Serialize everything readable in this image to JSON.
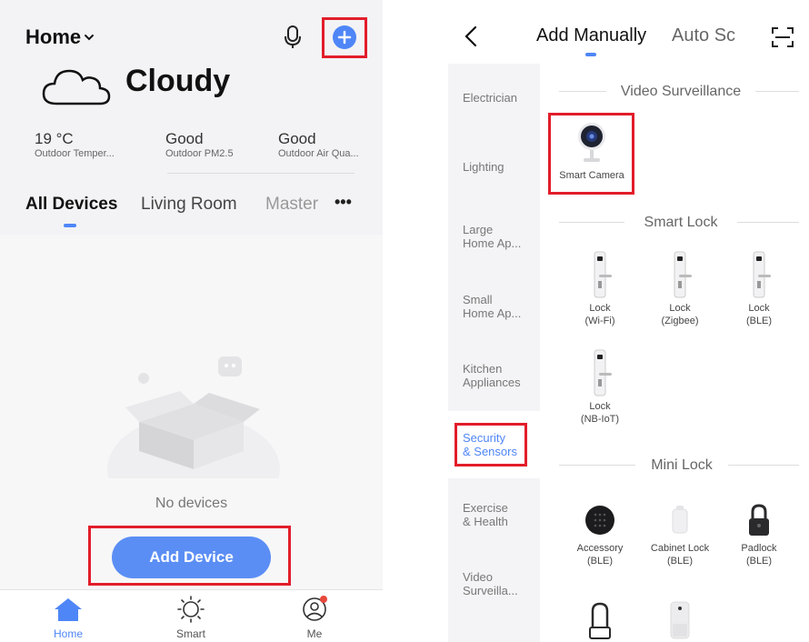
{
  "left": {
    "home_title": "Home",
    "weather": {
      "condition": "Cloudy"
    },
    "stats": [
      {
        "value": "19 °C",
        "label": "Outdoor Temper..."
      },
      {
        "value": "Good",
        "label": "Outdoor PM2.5"
      },
      {
        "value": "Good",
        "label": "Outdoor Air Qua..."
      }
    ],
    "tabs": [
      "All Devices",
      "Living Room",
      "Master"
    ],
    "more_label": "•••",
    "empty_text": "No devices",
    "add_button": "Add Device",
    "nav": [
      "Home",
      "Smart",
      "Me"
    ],
    "colors": {
      "accent": "#4f86f7",
      "highlight": "#e21d2a"
    }
  },
  "right": {
    "tabs": [
      "Add Manually",
      "Auto Sc"
    ],
    "categories": [
      "Electrician",
      "Lighting",
      "Large\nHome Ap...",
      "Small\nHome Ap...",
      "Kitchen\nAppliances",
      "Security\n& Sensors",
      "Exercise\n& Health",
      "Video\nSurveilla..."
    ],
    "sections": [
      {
        "title": "Video Surveillance",
        "devices": [
          "Smart Camera"
        ]
      },
      {
        "title": "Smart Lock",
        "devices": [
          "Lock\n(Wi-Fi)",
          "Lock\n(Zigbee)",
          "Lock\n(BLE)",
          "Lock\n(NB-IoT)"
        ]
      },
      {
        "title": "Mini Lock",
        "devices": [
          "Accessory\n(BLE)",
          "Cabinet Lock\n(BLE)",
          "Padlock\n(BLE)"
        ]
      }
    ]
  }
}
